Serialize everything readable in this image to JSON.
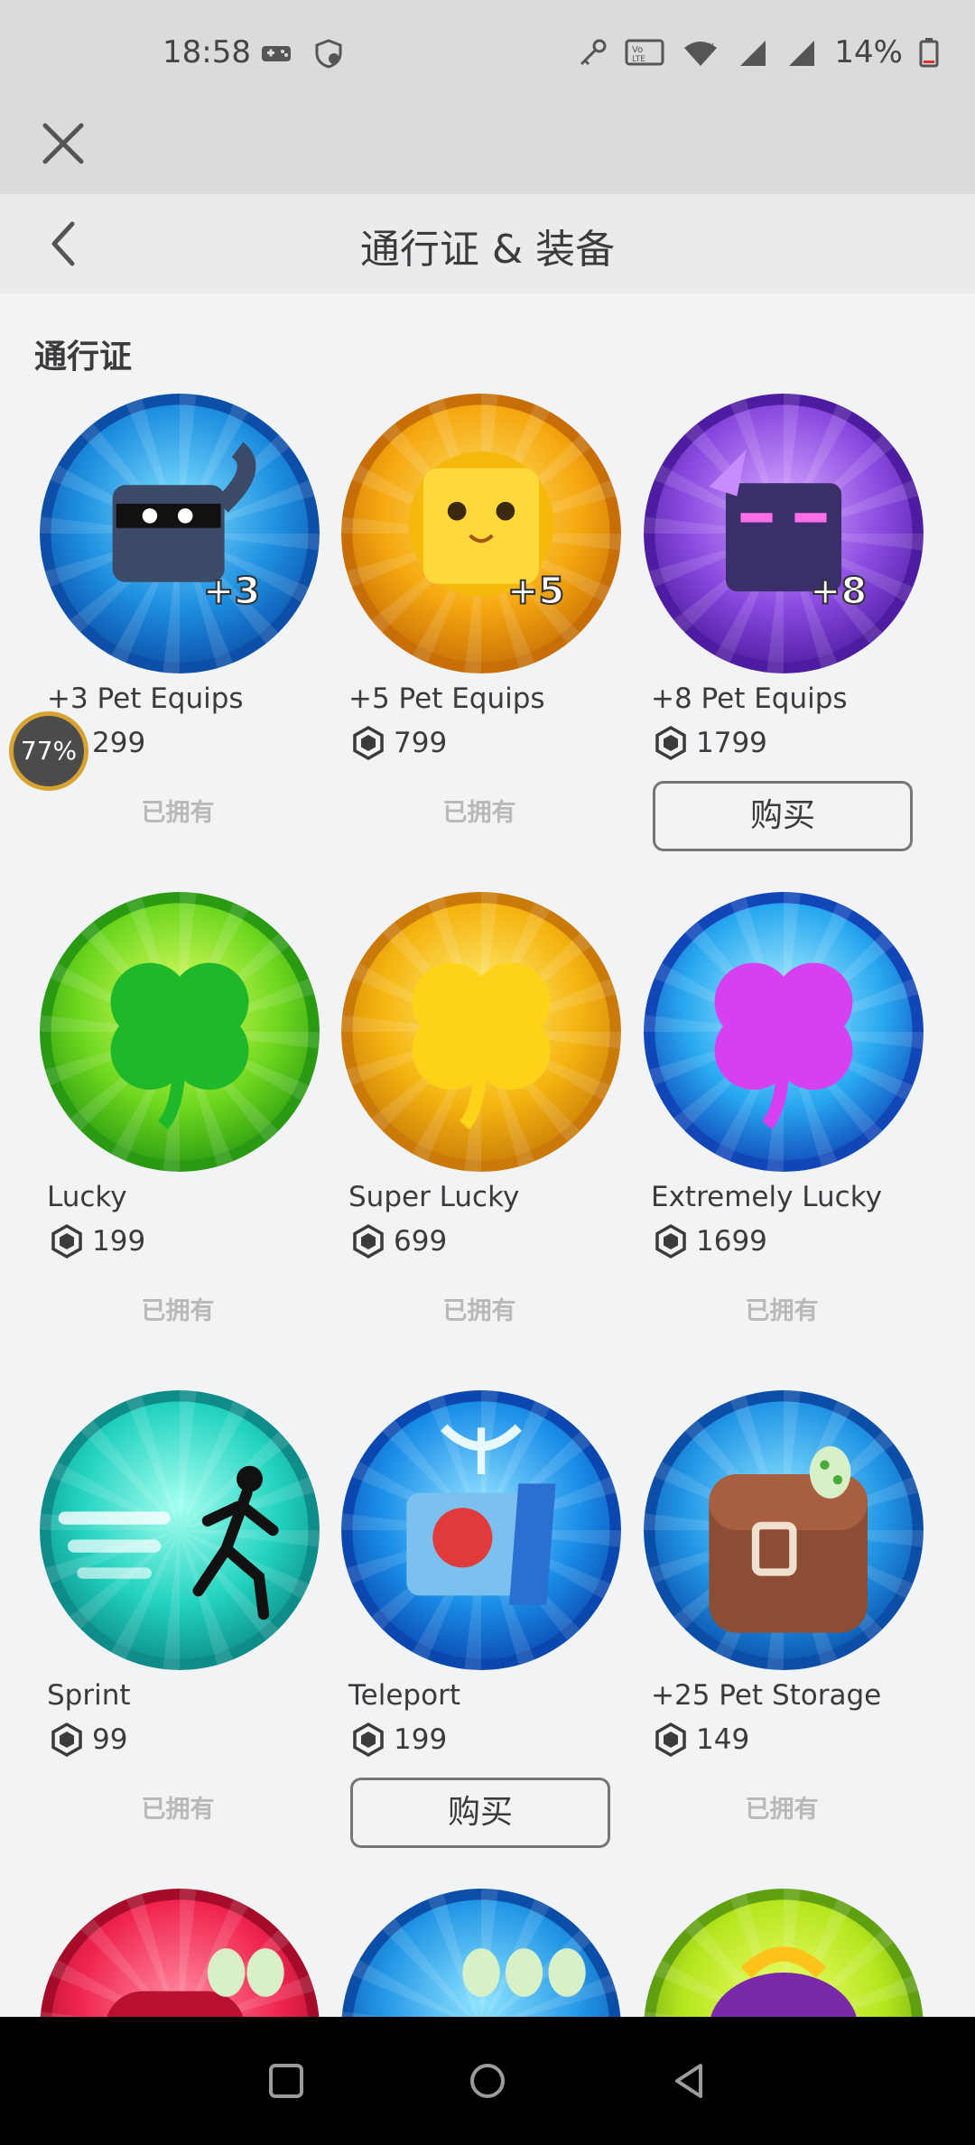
{
  "status_bar": {
    "time": "18:58",
    "battery": "14%",
    "icons": [
      "gamepad-icon",
      "shield-icon",
      "key-icon",
      "volte-icon",
      "wifi-icon",
      "signal-icon",
      "signal-icon-2",
      "battery-icon"
    ]
  },
  "header": {
    "title": "通行证 & 装备"
  },
  "section": {
    "title": "通行证"
  },
  "progress_bubble": "77%",
  "items": [
    {
      "name": "+3 Pet Equips",
      "price": "299",
      "status": "已拥有",
      "theme": "blue-cat-badge"
    },
    {
      "name": "+5 Pet Equips",
      "price": "799",
      "status": "已拥有",
      "theme": "gold-lion-badge"
    },
    {
      "name": "+8 Pet Equips",
      "price": "1799",
      "status": "购买",
      "theme": "purple-wolf-badge"
    },
    {
      "name": "Lucky",
      "price": "199",
      "status": "已拥有",
      "theme": "green-clover-badge"
    },
    {
      "name": "Super Lucky",
      "price": "699",
      "status": "已拥有",
      "theme": "gold-clover-badge"
    },
    {
      "name": "Extremely Lucky",
      "price": "1699",
      "status": "已拥有",
      "theme": "blue-clover-badge"
    },
    {
      "name": "Sprint",
      "price": "99",
      "status": "已拥有",
      "theme": "teal-runner-badge"
    },
    {
      "name": "Teleport",
      "price": "199",
      "status": "购买",
      "theme": "blue-teleport-badge"
    },
    {
      "name": "+25 Pet Storage",
      "price": "149",
      "status": "已拥有",
      "theme": "brown-backpack-badge"
    }
  ],
  "colors": {
    "background": "#f2f3f5",
    "text": "#393b3d",
    "owned_text": "#b8b9bb"
  }
}
